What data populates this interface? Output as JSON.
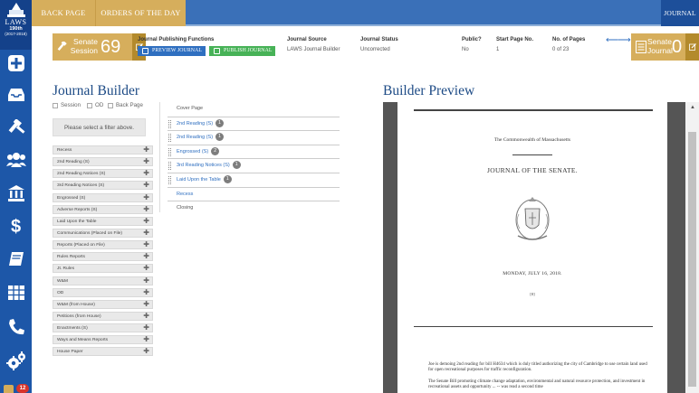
{
  "app": {
    "logo_text": "LAWS",
    "session_label": "190th",
    "session_years": "(2017-2018)",
    "notification_count": "12"
  },
  "topnav": {
    "back_page": "BACK PAGE",
    "orders_of_the_day": "ORDERS OF THE DAY",
    "journal": "JOURNAL"
  },
  "session": {
    "chamber": "Senate",
    "label": "Session",
    "number": "69"
  },
  "publishing": {
    "title": "Journal Publishing Functions",
    "preview_button": "PREVIEW JOURNAL",
    "publish_button": "PUBLISH JOURNAL"
  },
  "journal_info": {
    "source_label": "Journal Source",
    "source_value": "LAWS Journal Builder",
    "status_label": "Journal Status",
    "status_value": "Uncorrected",
    "public_label": "Public?",
    "public_value": "No",
    "start_page_label": "Start Page No.",
    "start_page_value": "1",
    "pages_label": "No. of Pages",
    "pages_value": "0 of 23"
  },
  "senate_journal": {
    "chamber": "Senate",
    "label": "Journal",
    "number": "0"
  },
  "builder": {
    "title": "Journal Builder",
    "filters": [
      "Session",
      "OD",
      "Back Page"
    ],
    "select_prompt": "Please select a filter above.",
    "items": [
      "Recess",
      "2nd Reading (S)",
      "2nd Reading Notices (S)",
      "3rd Reading Notices (S)",
      "Engrossed (S)",
      "Adverse Reports (S)",
      "Laid Upon the Table",
      "Communications (Placed on File)",
      "Reports (Placed on File)",
      "Rules Reports",
      "Jt. Rules",
      "W&M",
      "OD",
      "W&M (from House)",
      "Petitions (from House)",
      "Enactments (S)",
      "Ways and Means Reports",
      "House Paper"
    ],
    "sections": [
      {
        "label": "Cover Page",
        "count": ""
      },
      {
        "label": "2nd Reading (S)",
        "count": "1"
      },
      {
        "label": "2nd Reading (S)",
        "count": "1"
      },
      {
        "label": "Engrossed (S)",
        "count": "2"
      },
      {
        "label": "3rd Reading Notices (S)",
        "count": "1"
      },
      {
        "label": "Laid Upon the Table",
        "count": "1"
      },
      {
        "label": "Recess",
        "count": ""
      },
      {
        "label": "Closing",
        "count": ""
      }
    ]
  },
  "preview": {
    "title": "Builder Preview",
    "commonwealth": "The Commonwealth of Massachusetts",
    "journal_heading": "JOURNAL OF THE SENATE.",
    "date": "MONDAY, JULY 16, 2018.",
    "page_marker": "[0]",
    "para1": "Joe is demoing 2nd reading for bill H4634 which is duly titled authorizing the city of Cambridge to use certain land used for open recreational purposes for traffic reconfiguration.",
    "para2": "The Senate Bill promoting climate change adaptation, environmental and natural resource protection, and investment in recreational assets and opportunity ... -- was read a second time"
  }
}
